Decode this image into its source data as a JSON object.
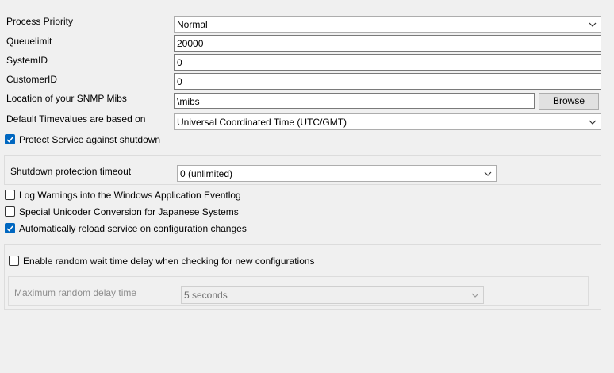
{
  "settings": {
    "process_priority": {
      "label": "Process Priority",
      "value": "Normal"
    },
    "queuelimit": {
      "label": "Queuelimit",
      "value": "20000"
    },
    "system_id": {
      "label": "SystemID",
      "value": "0"
    },
    "customer_id": {
      "label": "CustomerID",
      "value": "0"
    },
    "snmp_mibs": {
      "label": "Location of your SNMP Mibs",
      "value": "\\mibs",
      "browse_label": "Browse"
    },
    "timevalues": {
      "label": "Default Timevalues are based on",
      "value": "Universal Coordinated Time (UTC/GMT)"
    },
    "protect_service": {
      "label": "Protect Service against shutdown",
      "checked": true
    },
    "shutdown_timeout": {
      "label": "Shutdown protection timeout",
      "value": "0 (unlimited)"
    },
    "log_warnings": {
      "label": "Log Warnings into the Windows Application Eventlog",
      "checked": false
    },
    "unicode_conversion": {
      "label": "Special Unicoder Conversion for Japanese Systems",
      "checked": false
    },
    "auto_reload": {
      "label": "Automatically reload service on configuration changes",
      "checked": true
    },
    "random_wait": {
      "label": "Enable random wait time delay when checking for new configurations",
      "checked": false
    },
    "max_random_delay": {
      "label": "Maximum random delay time",
      "value": "5 seconds"
    }
  },
  "colors": {
    "accent": "#0067c0",
    "background": "#f0f0f0"
  }
}
